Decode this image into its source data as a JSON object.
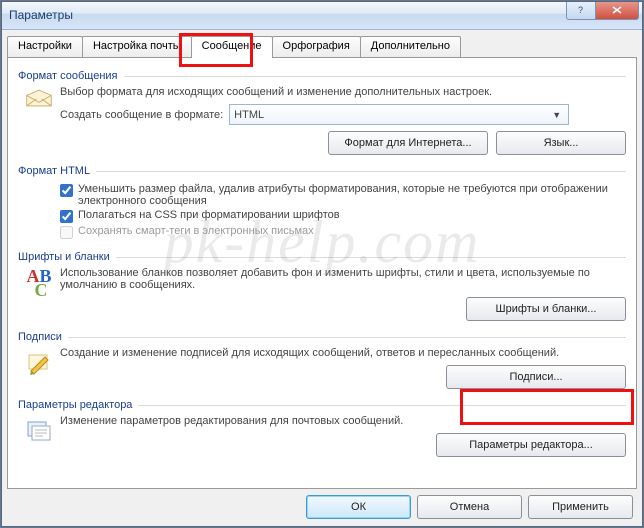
{
  "window": {
    "title": "Параметры"
  },
  "tabs": [
    {
      "label": "Настройки"
    },
    {
      "label": "Настройка почты"
    },
    {
      "label": "Сообщение"
    },
    {
      "label": "Орфография"
    },
    {
      "label": "Дополнительно"
    }
  ],
  "groups": {
    "format": {
      "title": "Формат сообщения",
      "desc": "Выбор формата для исходящих сообщений и изменение дополнительных настроек.",
      "row_label": "Создать сообщение в формате:",
      "dropdown_value": "HTML",
      "btn_internet": "Формат для Интернета...",
      "btn_lang": "Язык..."
    },
    "html": {
      "title": "Формат HTML",
      "chk1": "Уменьшить размер файла, удалив атрибуты форматирования, которые не требуются при отображении электронного сообщения",
      "chk2": "Полагаться на CSS при форматировании шрифтов",
      "chk3": "Сохранять смарт-теги в электронных письмах"
    },
    "fonts": {
      "title": "Шрифты и бланки",
      "desc": "Использование бланков позволяет добавить фон и изменить шрифты, стили и цвета, используемые по умолчанию в сообщениях.",
      "btn": "Шрифты и бланки..."
    },
    "sig": {
      "title": "Подписи",
      "desc": "Создание и изменение подписей для исходящих сообщений, ответов и пересланных сообщений.",
      "btn": "Подписи..."
    },
    "editor": {
      "title": "Параметры редактора",
      "desc": "Изменение параметров редактирования для почтовых сообщений.",
      "btn": "Параметры редактора..."
    }
  },
  "footer": {
    "ok": "ОК",
    "cancel": "Отмена",
    "apply": "Применить"
  },
  "watermark": "pk-help.com"
}
